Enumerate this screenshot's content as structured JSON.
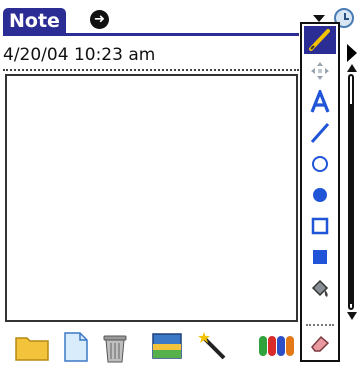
{
  "app": {
    "title": "Note"
  },
  "note": {
    "timestamp": "4/20/04 10:23 am"
  },
  "titlebar": {
    "info_icon_glyph": "➜"
  },
  "toolbar": {
    "tools": [
      {
        "id": "pencil",
        "icon": "pencil-icon",
        "selected": true
      },
      {
        "id": "move",
        "icon": "move-arrows-icon",
        "selected": false
      },
      {
        "id": "text",
        "icon": "text-a-icon",
        "selected": false
      },
      {
        "id": "line",
        "icon": "line-icon",
        "selected": false
      },
      {
        "id": "circle-outline",
        "icon": "circle-outline-icon",
        "selected": false
      },
      {
        "id": "circle-filled",
        "icon": "circle-filled-icon",
        "selected": false
      },
      {
        "id": "square-outline",
        "icon": "square-outline-icon",
        "selected": false
      },
      {
        "id": "square-filled",
        "icon": "square-filled-icon",
        "selected": false
      },
      {
        "id": "fill",
        "icon": "paint-bucket-icon",
        "selected": false
      },
      {
        "id": "eraser",
        "icon": "eraser-icon",
        "selected": false
      }
    ]
  },
  "bottom_toolbar": {
    "icons": [
      "folder-icon",
      "new-document-icon",
      "trash-icon",
      "background-image-icon",
      "magic-wand-icon",
      "color-palette-icon"
    ]
  },
  "colors": {
    "accent": "#2c2d94",
    "tool_blue": "#1f55d6",
    "pencil_yellow": "#f2c200"
  }
}
